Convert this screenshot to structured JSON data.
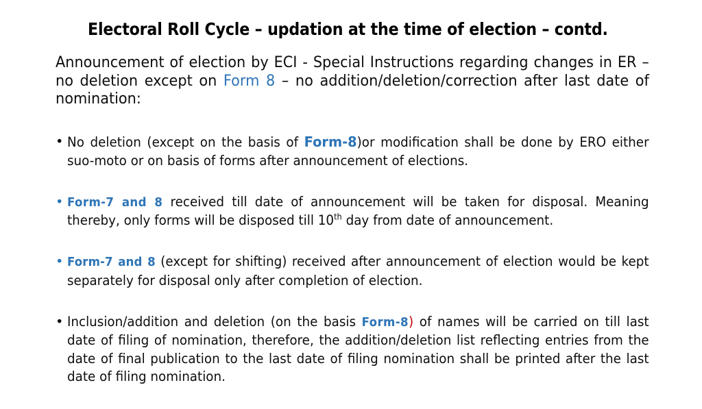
{
  "slide": {
    "background_color": "#FFFFFF",
    "accent_blue": "#2E75B6",
    "accent_red": "#C00000",
    "text_color": "#0D0D0D",
    "title": "Electoral Roll Cycle – updation at the time of election – contd.",
    "subtitle": {
      "part1": "Announcement of election by ECI - Special Instructions regarding changes in ER – no deletion except on ",
      "form_link": "Form 8",
      "part2": " – no addition/deletion/correction after last date of nomination:"
    },
    "bullets": [
      {
        "marker": "•",
        "marker_color": "#0D0D0D",
        "segments": [
          {
            "text": "No deletion (except on the basis of ",
            "style": "plain"
          },
          {
            "text": "Form-8",
            "style": "form-big"
          },
          {
            "text": ")or modification shall be done by ERO either suo-moto or on basis of forms after announcement of elections.",
            "style": "plain"
          }
        ]
      },
      {
        "marker": "•",
        "marker_color": "#2E75B6",
        "segments": [
          {
            "text": "Form-7 and 8",
            "style": "form"
          },
          {
            "text": " received till date of announcement will be taken for disposal. Meaning thereby,  only forms will be disposed till 10",
            "style": "plain"
          },
          {
            "text": "th",
            "style": "superscript"
          },
          {
            "text": " day from date of announcement.",
            "style": "plain"
          }
        ]
      },
      {
        "marker": "•",
        "marker_color": "#2E75B6",
        "segments": [
          {
            "text": "Form-7 and 8",
            "style": "form-tight"
          },
          {
            "text": " (except for shifting) received after announcement of election would be kept separately for disposal only after completion of election.",
            "style": "plain"
          }
        ]
      },
      {
        "marker": "•",
        "marker_color": "#0D0D0D",
        "segments": [
          {
            "text": "Inclusion/addition and deletion (on the basis ",
            "style": "plain"
          },
          {
            "text": "Form-8",
            "style": "form"
          },
          {
            "text": ")",
            "style": "red"
          },
          {
            "text": " of names will be carried on till last date of filing of nomination, therefore, the addition/deletion list reflecting entries from the date of final publication to the last date of filing nomination shall be printed after the last date of filing nomination.",
            "style": "plain"
          }
        ]
      }
    ]
  }
}
